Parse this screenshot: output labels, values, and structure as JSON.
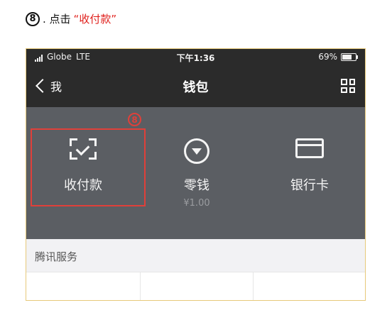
{
  "instruction": {
    "step_number": "8",
    "text": ". 点击 ",
    "highlight": "“收付款”"
  },
  "statusbar": {
    "carrier": "Globe",
    "network": "LTE",
    "time": "下午1:36",
    "battery": "69%"
  },
  "navbar": {
    "back_label": "我",
    "title": "钱包",
    "menu_icon": "grid-icon"
  },
  "wallet_tiles": [
    {
      "label": "收付款",
      "icon": "scan-check-icon"
    },
    {
      "label": "零钱",
      "sub": "¥1.00",
      "icon": "coin-icon"
    },
    {
      "label": "银行卡",
      "icon": "card-icon"
    }
  ],
  "annotation": {
    "marker": "8",
    "color": "#e0403a"
  },
  "section": {
    "title": "腾讯服务"
  },
  "colors": {
    "panel": "#5b5e63",
    "bar": "#2b2b2b",
    "accent_red": "#e0201c"
  }
}
